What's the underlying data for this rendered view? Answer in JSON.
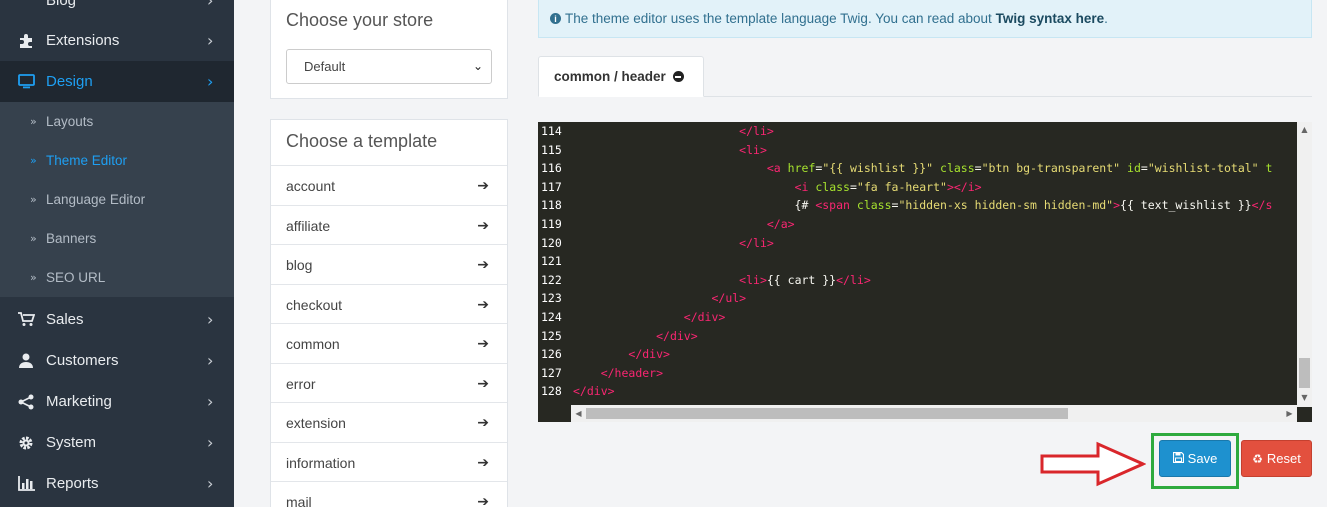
{
  "sidebar": {
    "top_partial": "Blog",
    "items": [
      {
        "label": "Extensions",
        "icon": "puzzle-icon"
      },
      {
        "label": "Design",
        "icon": "monitor-icon"
      },
      {
        "label": "Sales",
        "icon": "cart-icon"
      },
      {
        "label": "Customers",
        "icon": "user-icon"
      },
      {
        "label": "Marketing",
        "icon": "share-icon"
      },
      {
        "label": "System",
        "icon": "gear-icon"
      },
      {
        "label": "Reports",
        "icon": "bar-chart-icon"
      }
    ],
    "design_sub": [
      {
        "label": "Layouts"
      },
      {
        "label": "Theme Editor"
      },
      {
        "label": "Language Editor"
      },
      {
        "label": "Banners"
      },
      {
        "label": "SEO URL"
      }
    ],
    "active_color": "#1e9ff2"
  },
  "store_panel": {
    "title": "Choose your store",
    "selected": "Default"
  },
  "template_panel": {
    "title": "Choose a template",
    "items": [
      "account",
      "affiliate",
      "blog",
      "checkout",
      "common",
      "error",
      "extension",
      "information",
      "mail"
    ]
  },
  "alert": {
    "text": "The theme editor uses the template language Twig. You can read about ",
    "link": "Twig syntax here",
    "suffix": "."
  },
  "tab": {
    "label": "common / header"
  },
  "code": {
    "lines": [
      {
        "n": "114",
        "html": "                        <span class=\"tg\">&lt;/li&gt;</span>"
      },
      {
        "n": "115",
        "html": "                        <span class=\"tg\">&lt;li&gt;</span>"
      },
      {
        "n": "116",
        "html": "                            <span class=\"tg\">&lt;a</span> <span class=\"at\">href</span>=<span class=\"st\">\"{{ wishlist }}\"</span> <span class=\"at\">class</span>=<span class=\"st\">\"btn bg-transparent\"</span> <span class=\"at\">id</span>=<span class=\"st\">\"wishlist-total\"</span> <span class=\"at\">t</span>"
      },
      {
        "n": "117",
        "html": "                                <span class=\"tg\">&lt;i</span> <span class=\"at\">class</span>=<span class=\"st\">\"fa fa-heart\"</span><span class=\"tg\">&gt;&lt;/i&gt;</span>"
      },
      {
        "n": "118",
        "html": "                                {# <span class=\"tg\">&lt;span</span> <span class=\"at\">class</span>=<span class=\"st\">\"hidden-xs hidden-sm hidden-md\"</span><span class=\"tg\">&gt;</span>{{ text_wishlist }}<span class=\"tg\">&lt;/s</span>"
      },
      {
        "n": "119",
        "html": "                            <span class=\"tg\">&lt;/a&gt;</span>"
      },
      {
        "n": "120",
        "html": "                        <span class=\"tg\">&lt;/li&gt;</span>"
      },
      {
        "n": "121",
        "html": ""
      },
      {
        "n": "122",
        "html": "                        <span class=\"tg\">&lt;li&gt;</span>{{ cart }}<span class=\"tg\">&lt;/li&gt;</span>"
      },
      {
        "n": "123",
        "html": "                    <span class=\"tg\">&lt;/ul&gt;</span>"
      },
      {
        "n": "124",
        "html": "                <span class=\"tg\">&lt;/div&gt;</span>"
      },
      {
        "n": "125",
        "html": "            <span class=\"tg\">&lt;/div&gt;</span>"
      },
      {
        "n": "126",
        "html": "        <span class=\"tg\">&lt;/div&gt;</span>"
      },
      {
        "n": "127",
        "html": "    <span class=\"tg\">&lt;/header&gt;</span>"
      },
      {
        "n": "128",
        "html": "<span class=\"tg\">&lt;/div&gt;</span>"
      }
    ]
  },
  "buttons": {
    "save": "Save",
    "reset": "Reset",
    "save_color": "#1e91cf",
    "reset_color": "#e3503e",
    "highlight_color": "#2eaa3e",
    "arrow_color": "#d9262b"
  }
}
